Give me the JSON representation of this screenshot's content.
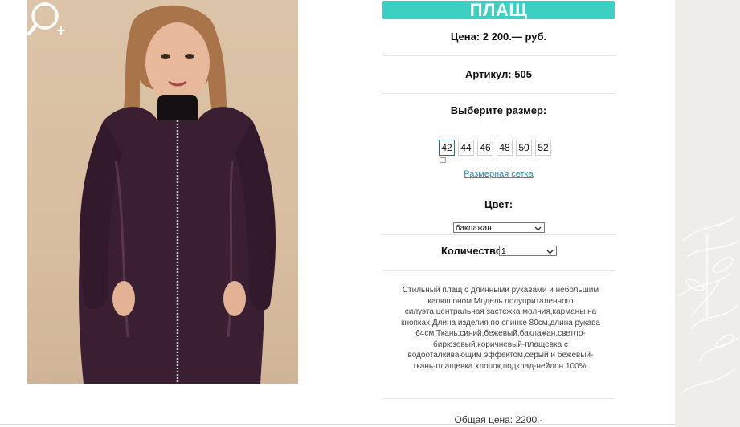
{
  "product": {
    "title": "ПЛАЩ",
    "price": "Цена: 2 200.— руб.",
    "article": "Артикул: 505",
    "choose_size": "Выберите размер:",
    "sizes": [
      "42",
      "44",
      "46",
      "48",
      "50",
      "52"
    ],
    "selected_size": "42",
    "size_chart_link": "Размерная сетка",
    "color_label": "Цвет:",
    "color_value": "баклажан",
    "quantity_label": "Количество:",
    "quantity_value": "1",
    "description": "Стильный плащ с длинными рукавами и небольшим капюшоном.Модель полуприталенного силуэта,центральная застежка молния,карманы на кнопках.Длина изделия по спинке 80см,длина рукава 64см.Ткань:синий,бежевый,баклажан,светло-бирюзовый,коричневый-плащевка с водооталкивающим эффектом,серый и бежевый-ткань-плащевка хлопок,подклад-нейлон 100%.",
    "total": "Общая цена: 2200.-"
  },
  "icons": {
    "zoom": "zoom-in-icon",
    "dropdown": "chevron-down-icon"
  },
  "colors": {
    "title_bar": "#3ecfc3",
    "link": "#2a8fb5",
    "coat": "#3a1f33"
  }
}
